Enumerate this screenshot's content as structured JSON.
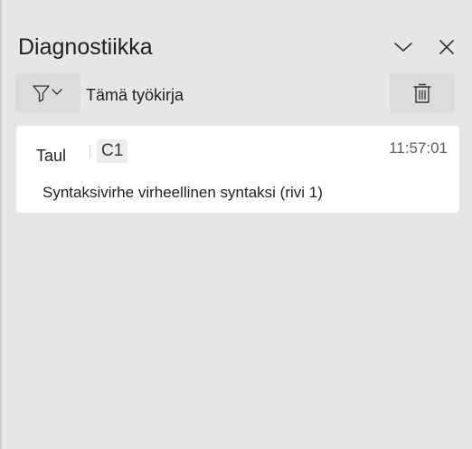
{
  "panel": {
    "title": "Diagnostiikka"
  },
  "icons": {
    "collapse": "chevron-down-icon",
    "close": "close-icon",
    "filter": "filter-icon",
    "delete": "trash-icon"
  },
  "toolbar": {
    "filter_scope": "Tämä työkirja"
  },
  "entries": [
    {
      "sheet": "Taul",
      "cell": "C1",
      "time": "11:57:01",
      "message": "Syntaksivirhe virheellinen syntaksi (rivi 1)"
    }
  ],
  "colors": {
    "panel_bg": "#e6e6e6",
    "card_bg": "#ffffff",
    "button_bg": "#dcdcdc"
  }
}
